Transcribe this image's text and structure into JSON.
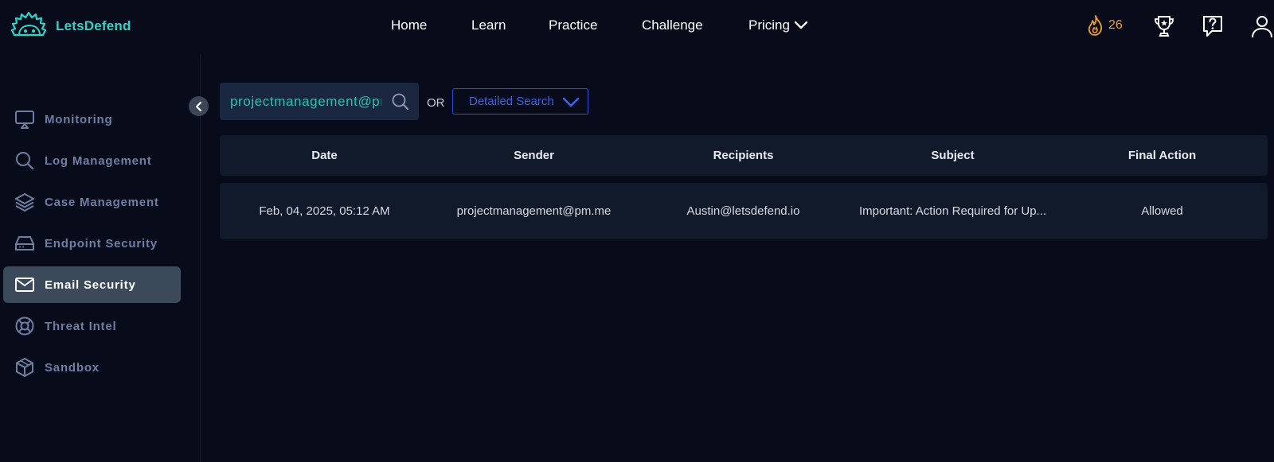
{
  "brand": {
    "name": "LetsDefend",
    "color": "#2fd3c8"
  },
  "nav": {
    "home": "Home",
    "learn": "Learn",
    "practice": "Practice",
    "challenge": "Challenge",
    "pricing": "Pricing"
  },
  "streak": {
    "count": "26",
    "color": "#f0a02c"
  },
  "header_icons": [
    "fire-icon",
    "trophy-icon",
    "help-icon",
    "user-icon"
  ],
  "sidebar": {
    "items": [
      {
        "label": "Monitoring",
        "icon": "monitor-icon"
      },
      {
        "label": "Log Management",
        "icon": "search-icon"
      },
      {
        "label": "Case Management",
        "icon": "layers-icon"
      },
      {
        "label": "Endpoint Security",
        "icon": "drive-icon"
      },
      {
        "label": "Email Security",
        "icon": "mail-icon",
        "active": true
      },
      {
        "label": "Threat Intel",
        "icon": "lifebuoy-icon"
      },
      {
        "label": "Sandbox",
        "icon": "cube-icon"
      }
    ]
  },
  "search": {
    "value": "projectmanagement@pm.me",
    "or_label": "OR",
    "detailed_label": "Detailed Search"
  },
  "table": {
    "columns": [
      "Date",
      "Sender",
      "Recipients",
      "Subject",
      "Final Action"
    ],
    "rows": [
      {
        "date": "Feb, 04, 2025, 05:12 AM",
        "sender": "projectmanagement@pm.me",
        "recipients": "Austin@letsdefend.io",
        "subject": "Important: Action Required for Up...",
        "final_action": "Allowed"
      }
    ]
  },
  "colors": {
    "background": "#080b1a",
    "panel": "#111a2a",
    "accent_teal": "#2fd3c8",
    "accent_blue": "#2a50d8",
    "sidebar_active": "#3a4a5a"
  }
}
